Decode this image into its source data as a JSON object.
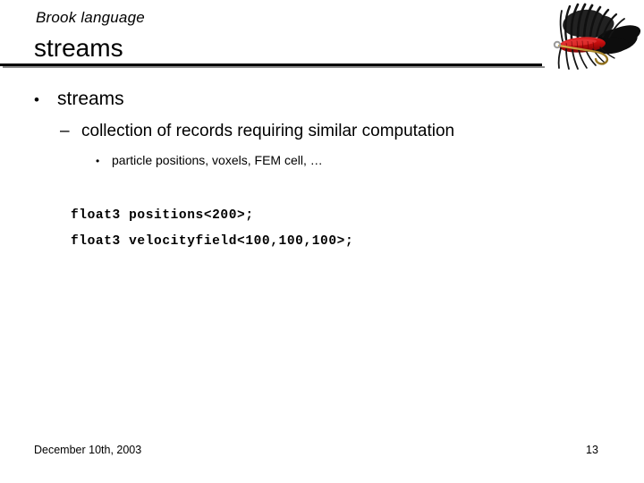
{
  "slide": {
    "kicker": "Brook language",
    "title": "streams",
    "accent_rule_color": "#000000",
    "accent_rule_shadow_color": "#8c8c8c"
  },
  "logo": {
    "name": "brook-fly-logo",
    "alt": "black fly-fishing fly with red body and gold hook",
    "feather_color": "#111111",
    "body_color": "#c40d0d",
    "hook_color": "#b08a24"
  },
  "bullets": [
    {
      "level": 1,
      "marker": "•",
      "text": "streams"
    },
    {
      "level": 2,
      "marker": "–",
      "text": "collection of records requiring similar computation"
    },
    {
      "level": 3,
      "marker": "•",
      "text": "particle positions, voxels, FEM cell, …"
    }
  ],
  "code": [
    "float3 positions<200>;",
    "float3 velocityfield<100,100,100>;"
  ],
  "footer": {
    "date": "December 10th, 2003",
    "page_number": "13"
  }
}
